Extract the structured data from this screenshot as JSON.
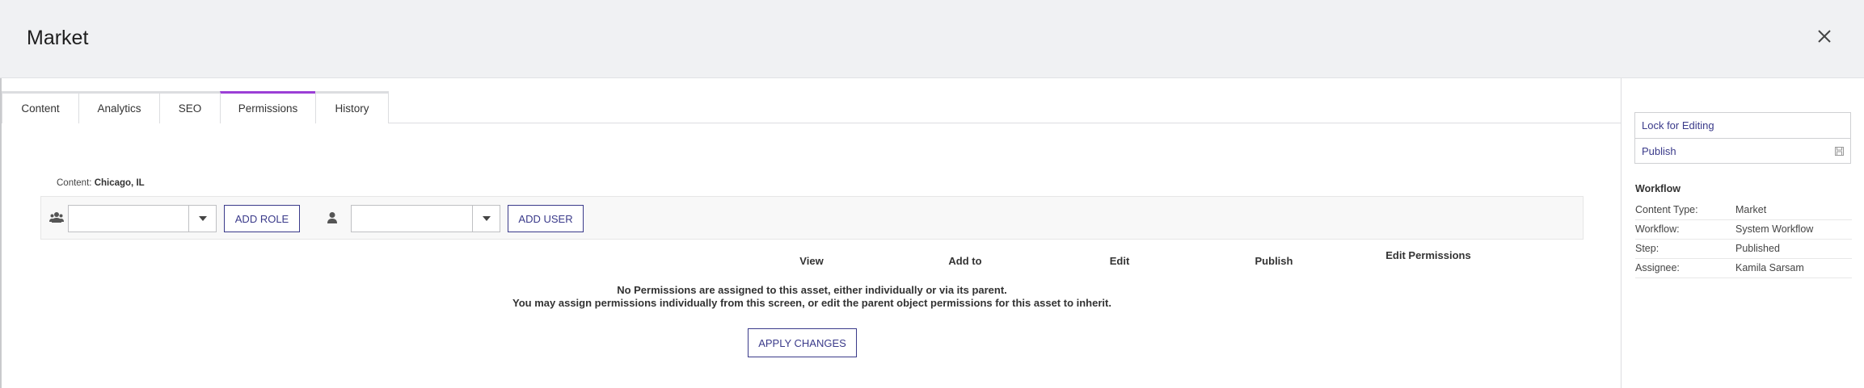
{
  "header": {
    "title": "Market"
  },
  "tabs": [
    {
      "label": "Content"
    },
    {
      "label": "Analytics"
    },
    {
      "label": "SEO"
    },
    {
      "label": "Permissions",
      "active": true
    },
    {
      "label": "History"
    }
  ],
  "permissions": {
    "content_label": "Content:",
    "content_value": "Chicago, IL",
    "role_select_value": "",
    "add_role_label": "ADD ROLE",
    "user_select_value": "",
    "add_user_label": "ADD USER",
    "columns": [
      "View",
      "Add to",
      "Edit",
      "Publish",
      "Edit Permissions"
    ],
    "message_line1": "No Permissions are assigned to this asset, either individually or via its parent.",
    "message_line2": "You may assign permissions individually from this screen, or edit the parent object permissions for this asset to inherit.",
    "apply_label": "APPLY CHANGES"
  },
  "sidebar": {
    "lock_label": "Lock for Editing",
    "publish_label": "Publish",
    "workflow_title": "Workflow",
    "rows": [
      {
        "key": "Content Type:",
        "value": "Market"
      },
      {
        "key": "Workflow:",
        "value": "System Workflow"
      },
      {
        "key": "Step:",
        "value": "Published"
      },
      {
        "key": "Assignee:",
        "value": "Kamila Sarsam"
      }
    ]
  },
  "colors": {
    "accent": "#9b3fd6",
    "link": "#3a3a8a",
    "header_bg": "#f0f1f3"
  },
  "icons": [
    "close-icon",
    "group-icon",
    "user-icon",
    "chevron-down-icon",
    "save-icon"
  ]
}
